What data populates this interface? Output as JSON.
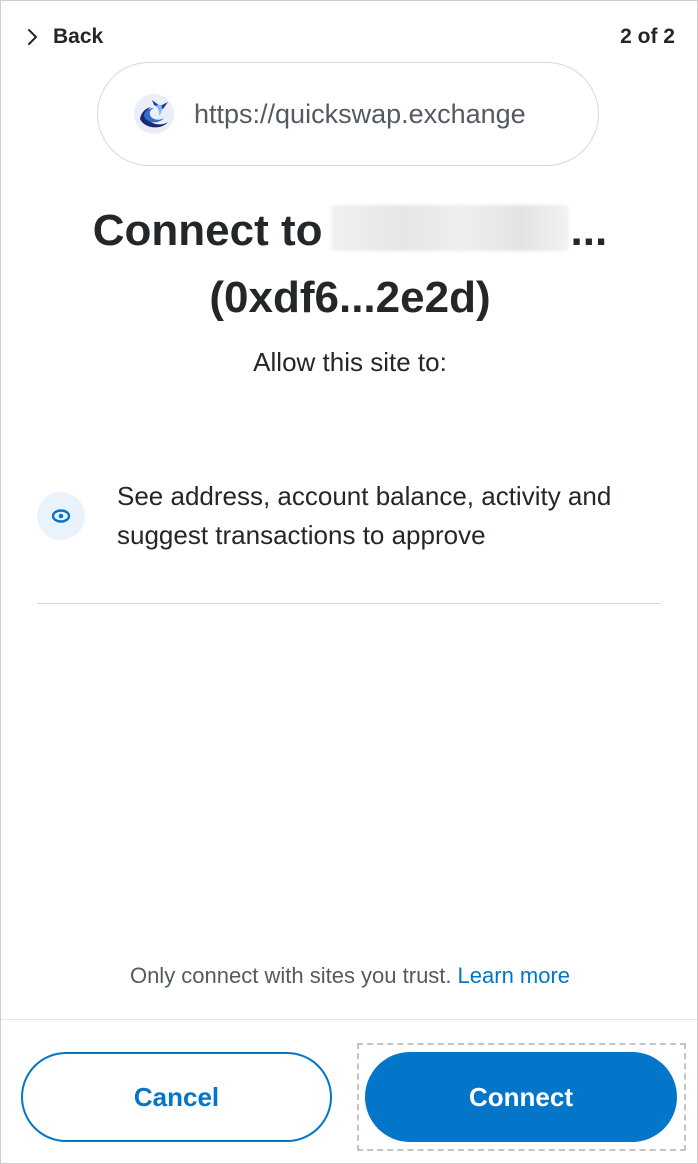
{
  "header": {
    "back_label": "Back",
    "step": "2 of 2"
  },
  "site": {
    "url": "https://quickswap.exchange",
    "logo_icon": "quickswap-logo-icon"
  },
  "title": {
    "prefix": "Connect to",
    "account_name_redacted": "",
    "ellipsis": "...",
    "address": "(0xdf6...2e2d)"
  },
  "permissions": {
    "heading": "Allow this site to:",
    "items": [
      {
        "icon": "eye-icon",
        "text": "See address, account balance, activity and suggest transactions to approve"
      }
    ]
  },
  "footer": {
    "trust_note": "Only connect with sites you trust.",
    "learn_more": "Learn more",
    "cancel_label": "Cancel",
    "connect_label": "Connect"
  },
  "colors": {
    "primary": "#0376c9",
    "text": "#24272a",
    "muted": "#535a61",
    "icon_bg": "#eaf2fb"
  }
}
